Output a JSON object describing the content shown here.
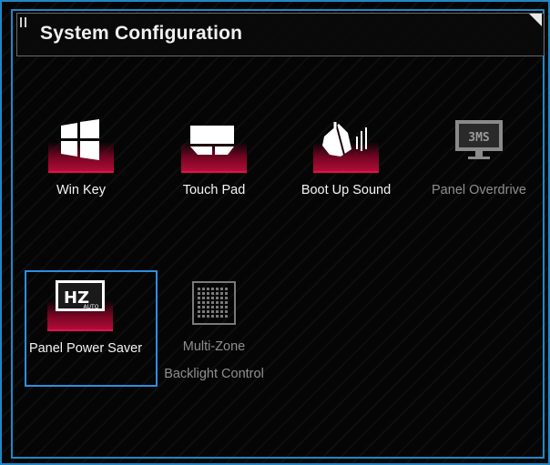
{
  "header": {
    "title": "System Configuration"
  },
  "tiles": [
    {
      "label": "Win Key",
      "icon": "windows-logo-icon",
      "enabled": true,
      "selected": false
    },
    {
      "label": "Touch Pad",
      "icon": "touchpad-icon",
      "enabled": true,
      "selected": false
    },
    {
      "label": "Boot Up Sound",
      "icon": "boot-sound-icon",
      "enabled": true,
      "selected": false
    },
    {
      "label": "Panel Overdrive",
      "icon": "monitor-3ms-icon",
      "icon_text": "3MS",
      "enabled": false,
      "selected": false
    },
    {
      "label": "Panel Power Saver",
      "icon": "hz-auto-icon",
      "icon_text": "HZ",
      "icon_subtext": "AUTO",
      "enabled": true,
      "selected": true
    },
    {
      "label_line1": "Multi-Zone",
      "label_line2": "Backlight Control",
      "icon": "keyboard-grid-icon",
      "enabled": false,
      "selected": false
    }
  ],
  "colors": {
    "frame": "#1e88c8",
    "selection": "#2b8fe0",
    "accent_glow": "#e2124a",
    "disabled_text": "#8f8f8f"
  }
}
